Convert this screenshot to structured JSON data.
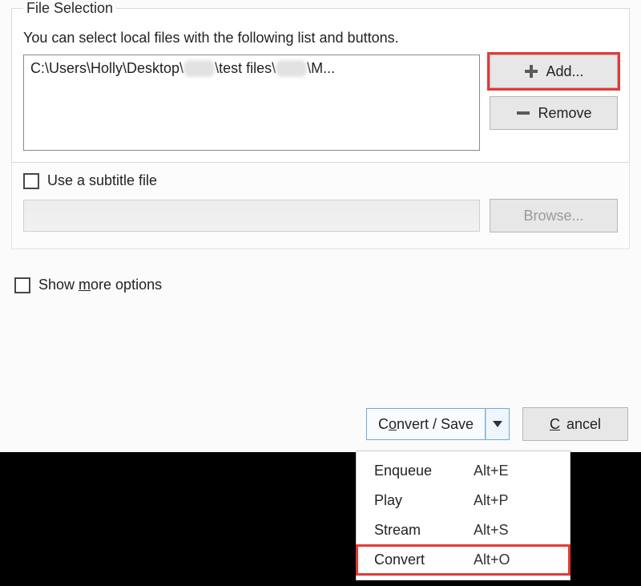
{
  "fileSelection": {
    "legend": "File Selection",
    "hint": "You can select local files with the following list and buttons.",
    "filePath": {
      "seg1": "C:\\Users\\Holly\\Desktop\\",
      "blur1": "xxx",
      "seg2": "\\test files\\",
      "blur2": "xxx",
      "seg3": "\\M..."
    },
    "addLabel": "Add...",
    "removeLabel": "Remove"
  },
  "subtitle": {
    "checkboxLabel": "Use a subtitle file",
    "browseLabel": "Browse..."
  },
  "showMore": {
    "prefix": "Show ",
    "underlined": "m",
    "suffix": "ore options"
  },
  "bottom": {
    "convertSavePrefix": "C",
    "convertSaveUnderlined": "o",
    "convertSaveSuffix": "nvert / Save",
    "cancelUnderlined": "C",
    "cancelSuffix": "ancel"
  },
  "menu": {
    "items": [
      {
        "label": "Enqueue",
        "shortcut": "Alt+E"
      },
      {
        "label": "Play",
        "shortcut": "Alt+P"
      },
      {
        "label": "Stream",
        "shortcut": "Alt+S"
      },
      {
        "label": "Convert",
        "shortcut": "Alt+O"
      }
    ]
  }
}
